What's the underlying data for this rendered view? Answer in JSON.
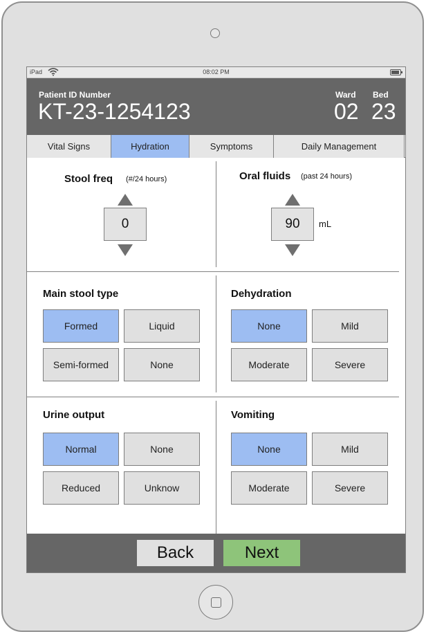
{
  "statusbar": {
    "carrier": "iPad",
    "time": "08:02 PM"
  },
  "header": {
    "patient_id_label": "Patient ID Number",
    "patient_id": "KT-23-1254123",
    "ward_label": "Ward",
    "ward": "02",
    "bed_label": "Bed",
    "bed": "23"
  },
  "tabs": [
    {
      "label": "Vital Signs",
      "active": false
    },
    {
      "label": "Hydration",
      "active": true
    },
    {
      "label": "Symptoms",
      "active": false
    },
    {
      "label": "Daily Management",
      "active": false
    }
  ],
  "stool_freq": {
    "title": "Stool freq",
    "subtitle": "(#/24 hours)",
    "value": "0"
  },
  "oral_fluids": {
    "title": "Oral fluids",
    "subtitle": "(past 24 hours)",
    "value": "90",
    "unit": "mL"
  },
  "main_stool_type": {
    "title": "Main stool type",
    "options": [
      "Formed",
      "Liquid",
      "Semi-formed",
      "None"
    ],
    "selected": "Formed"
  },
  "dehydration": {
    "title": "Dehydration",
    "options": [
      "None",
      "Mild",
      "Moderate",
      "Severe"
    ],
    "selected": "None"
  },
  "urine_output": {
    "title": "Urine output",
    "options": [
      "Normal",
      "None",
      "Reduced",
      "Unknow"
    ],
    "selected": "Normal"
  },
  "vomiting": {
    "title": "Vomiting",
    "options": [
      "None",
      "Mild",
      "Moderate",
      "Severe"
    ],
    "selected": "None"
  },
  "footer": {
    "back_label": "Back",
    "next_label": "Next"
  },
  "colors": {
    "header_bg": "#666666",
    "selected": "#9dbdf2",
    "next_button": "#8ec47a"
  }
}
